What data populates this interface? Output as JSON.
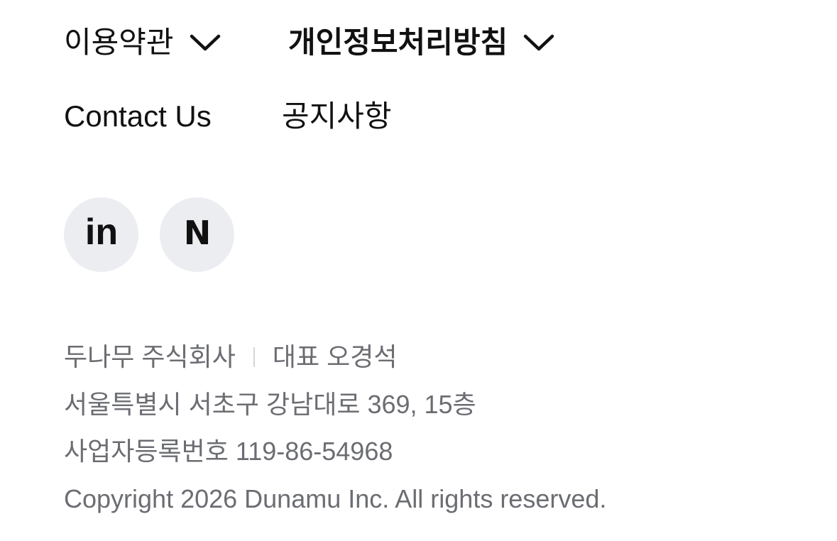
{
  "links": {
    "terms": "이용약관",
    "privacy": "개인정보처리방침",
    "contact": "Contact Us",
    "notice": "공지사항"
  },
  "icons": {
    "terms_chevron": "chevron-down-icon",
    "privacy_chevron": "chevron-down-icon",
    "linkedin": "linkedin-icon",
    "naver": "naver-icon"
  },
  "social": {
    "linkedin_text": "in",
    "naver_text": "N"
  },
  "company": {
    "name": "두나무 주식회사",
    "ceo": "대표 오경석",
    "address": "서울특별시 서초구 강남대로 369, 15층",
    "business_number": "사업자등록번호 119-86-54968",
    "copyright": "Copyright 2026 Dunamu Inc. All rights reserved."
  },
  "colors": {
    "text_primary": "#111111",
    "text_secondary": "#6b6d72",
    "icon_bg": "#ecedf1"
  }
}
